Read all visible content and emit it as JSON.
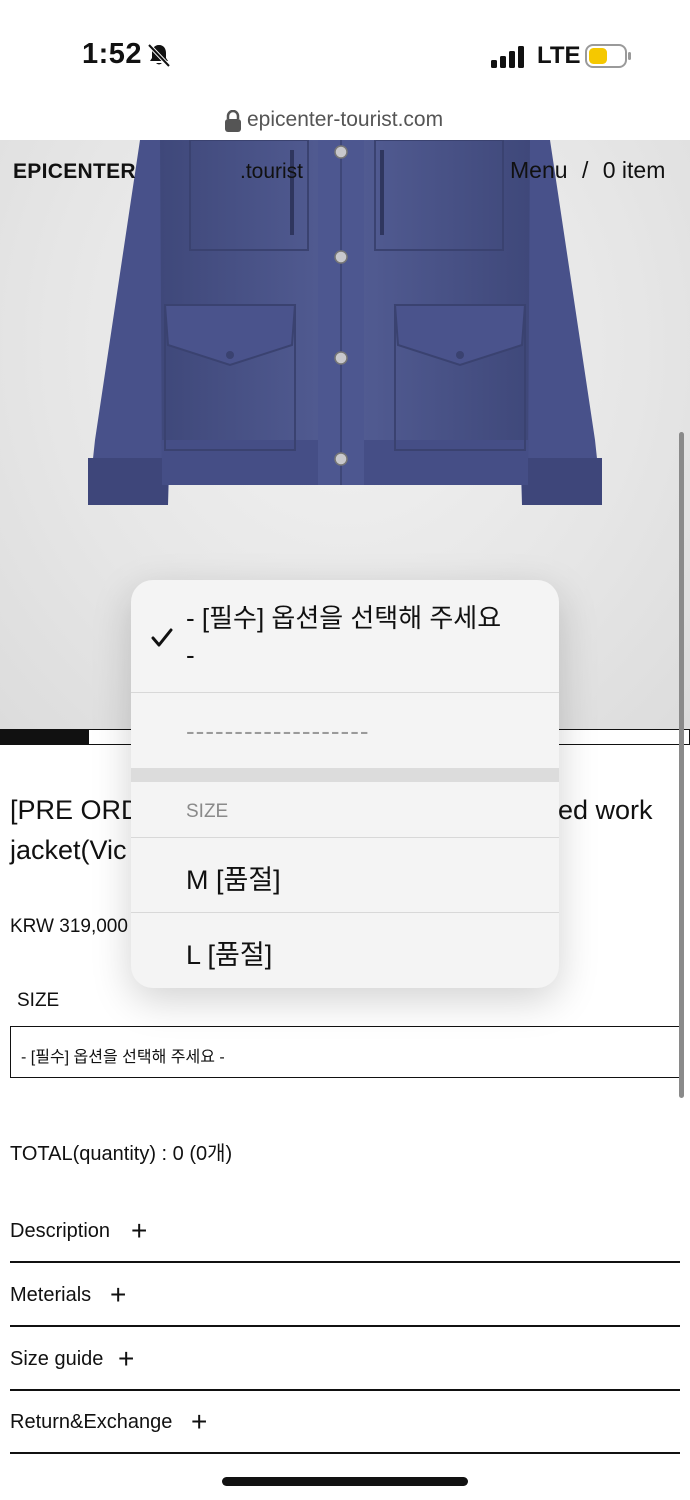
{
  "status": {
    "time": "1:52",
    "network": "LTE"
  },
  "browser": {
    "url": "epicenter-tourist.com"
  },
  "header": {
    "brand": "EPICENTER",
    "brand_sub": ".tourist",
    "menu": "Menu",
    "divider": "/",
    "cart": "0 item"
  },
  "product": {
    "title_line1": "[PRE ORD",
    "title_line1_end": "ed work",
    "title_line2": "jacket(Vic",
    "price": "KRW 319,000",
    "size_label": "SIZE",
    "size_select_value": "- [필수] 옵션을 선택해 주세요 -",
    "total": "TOTAL(quantity) : 0 (0개)"
  },
  "accordion": [
    {
      "label": "Description",
      "icon": "plus-icon"
    },
    {
      "label": "Meterials",
      "icon": "plus-icon"
    },
    {
      "label": "Size guide",
      "icon": "plus-icon"
    },
    {
      "label": "Return&Exchange",
      "icon": "plus-icon"
    }
  ],
  "dropdown": {
    "selected_option": "- [필수] 옵션을 선택해 주세요 -",
    "separator_option": "-------------------",
    "group_label": "SIZE",
    "options": [
      "M [품절]",
      "L [품절]"
    ]
  },
  "colors": {
    "jacket": "#4a5488",
    "battery": "#f5c800",
    "text": "#111111"
  }
}
